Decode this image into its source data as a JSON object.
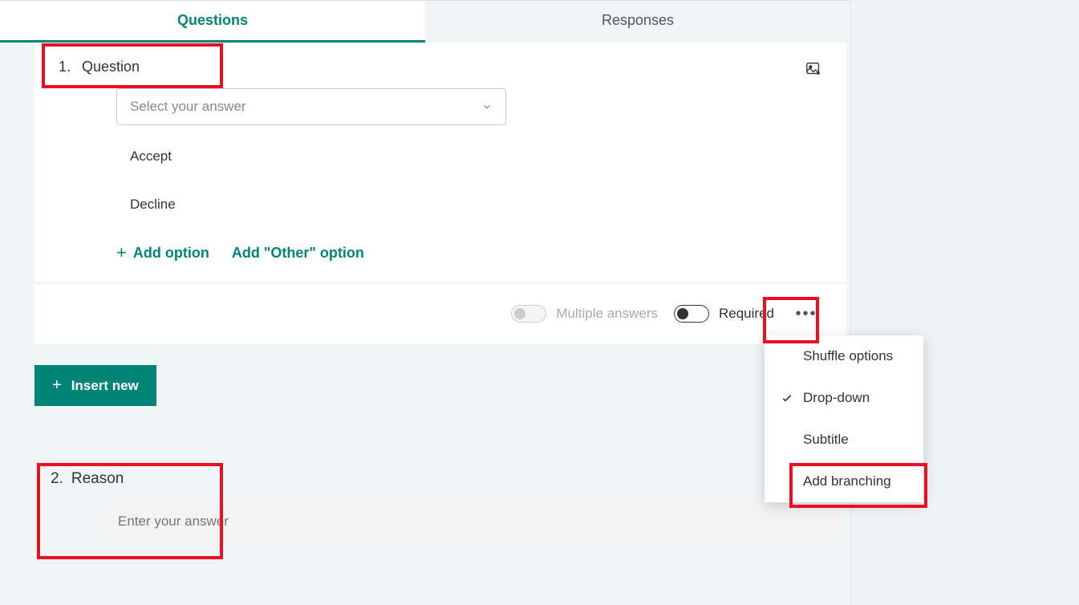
{
  "tabs": {
    "questions": "Questions",
    "responses": "Responses"
  },
  "question1": {
    "number": "1.",
    "title": "Question",
    "selectPlaceholder": "Select your answer",
    "options": [
      "Accept",
      "Decline"
    ],
    "addOption": "Add option",
    "addOther": "Add \"Other\" option",
    "multipleAnswers": "Multiple answers",
    "required": "Required"
  },
  "insertNew": "Insert new",
  "dropdown": {
    "shuffle": "Shuffle options",
    "dropdown": "Drop-down",
    "subtitle": "Subtitle",
    "addBranching": "Add branching"
  },
  "question2": {
    "number": "2.",
    "title": "Reason",
    "placeholder": "Enter your answer"
  }
}
